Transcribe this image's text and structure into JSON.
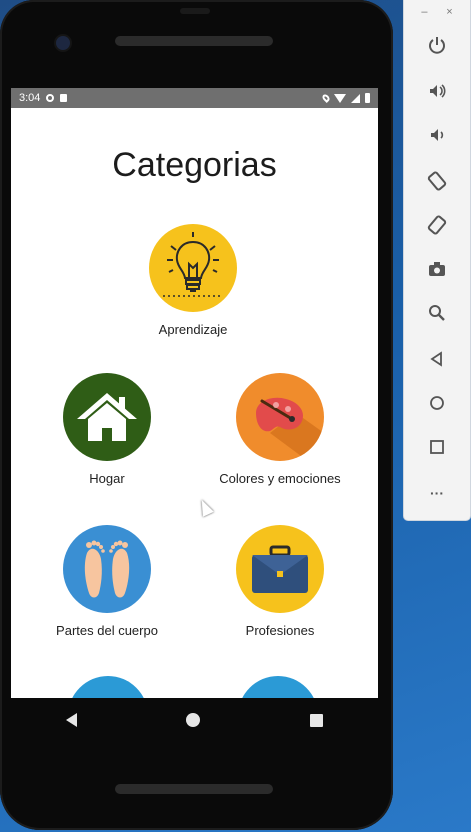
{
  "status_bar": {
    "time": "3:04"
  },
  "screen": {
    "title": "Categorias",
    "categories": [
      {
        "label": "Aprendizaje",
        "icon": "lightbulb-icon",
        "color": "#f6c21c"
      },
      {
        "label": "Hogar",
        "icon": "house-icon",
        "color": "#2f5d16"
      },
      {
        "label": "Colores y emociones",
        "icon": "palette-icon",
        "color": "#f08c2c"
      },
      {
        "label": "Partes del cuerpo",
        "icon": "feet-icon",
        "color": "#3a8fd3"
      },
      {
        "label": "Profesiones",
        "icon": "briefcase-icon",
        "color": "#f6c21c"
      }
    ]
  },
  "toolbar": {
    "minimize": "–",
    "close": "×",
    "more": "···"
  }
}
